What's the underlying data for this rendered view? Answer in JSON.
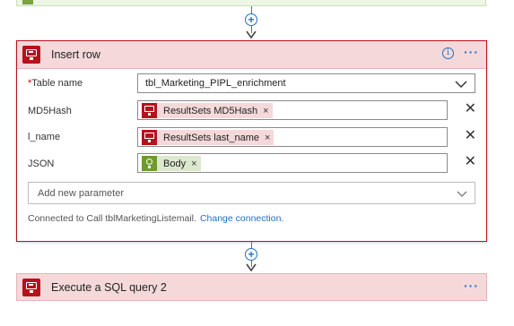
{
  "card": {
    "title": "Insert row",
    "info_symbol": "i",
    "more_symbol": "···",
    "fields": [
      {
        "label": "Table name",
        "required_mark": "*",
        "value": "tbl_Marketing_PIPL_enrichment"
      },
      {
        "label": "MD5Hash",
        "token": "ResultSets MD5Hash",
        "token_icon": "sql-icon"
      },
      {
        "label": "l_name",
        "token": "ResultSets last_name",
        "token_icon": "sql-icon"
      },
      {
        "label": "JSON",
        "token": "Body",
        "token_icon": "bulb-icon"
      }
    ],
    "token_remove": "×",
    "row_remove": "✕",
    "add_parameter_placeholder": "Add new parameter",
    "connection_text": "Connected to Call tblMarketingListemail.",
    "change_connection": "Change connection."
  },
  "next_card": {
    "title": "Execute a SQL query 2",
    "more_symbol": "···"
  },
  "connector": {
    "plus_symbol": "+"
  },
  "colors": {
    "sql_red": "#b5121b",
    "header_pink": "#f5d9da",
    "link_blue": "#1f6fc5",
    "token_green": "#6f9a2d"
  }
}
